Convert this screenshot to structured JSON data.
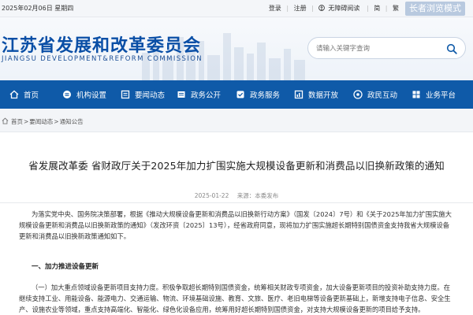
{
  "topbar": {
    "date": "2025年02月06日 星期四",
    "links": [
      "登录",
      "注册"
    ],
    "accessibility": "无障碍阅读",
    "lang": [
      "简",
      "繁"
    ],
    "elder_mode": "长者浏览模式"
  },
  "header": {
    "title": "江苏省发展和改革委员会",
    "subtitle": "JIANGSU DEVELOPMENT&REFORM COMMISSION",
    "search_placeholder": "请输入关键字查询"
  },
  "nav": {
    "items": [
      {
        "label": "首页",
        "icon": "home-icon"
      },
      {
        "label": "机构设置",
        "icon": "org-icon"
      },
      {
        "label": "要闻动态",
        "icon": "news-icon"
      },
      {
        "label": "政务公开",
        "icon": "disclosure-icon"
      },
      {
        "label": "政务服务",
        "icon": "service-icon"
      },
      {
        "label": "数据开放",
        "icon": "data-icon"
      },
      {
        "label": "政民互动",
        "icon": "interaction-icon"
      },
      {
        "label": "业务平台",
        "icon": "platform-icon"
      }
    ],
    "bg_color": "#0f5aa8"
  },
  "breadcrumb": {
    "items": [
      "首页",
      "要闻动态",
      "通知公告"
    ],
    "separator": ">"
  },
  "article": {
    "title": "省发展改革委  省财政厅关于2025年加力扩围实施大规模设备更新和消费品以旧换新政策的通知",
    "date": "2025-01-22",
    "source": "来源：本委发布",
    "para1": "为落实党中央、国务院决策部署，根据《推动大规模设备更新和消费品以旧换新行动方案》（国发〔2024〕7号）和《关于2025年加力扩围实施大规模设备更新和消费品以旧换新政策的通知》（发改环资〔2025〕13号），经省政府同意，现将加力扩围实施超长期特别国债资金支持我省大规模设备更新和消费品以旧换新政策通知如下。",
    "section1": "一、加力推进设备更新",
    "para2": "（一）加大重点领域设备更新项目支持力度。积极争取超长期特别国债资金，统筹相关财政专项资金，加大设备更新项目的投资补助支持力度。在继续支持工业、用能设备、能源电力、交通运输、物流、环境基础设施、教育、文旅、医疗、老旧电梯等设备更新基础上，新增支持电子信息、安全生产、设施农业等领域，重点支持高端化、智能化、绿色化设备应用，统筹用好超长期特别国债资金，对支持大规模设备更新的项目给予支持。"
  }
}
